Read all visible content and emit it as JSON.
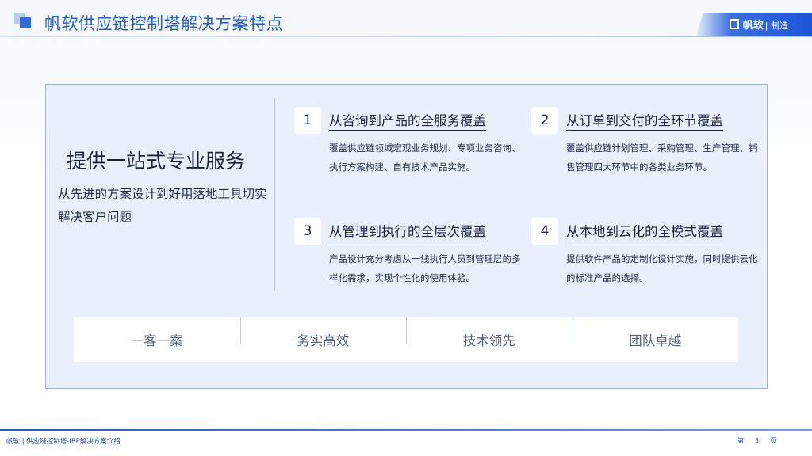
{
  "header": {
    "title": "帆软供应链控制塔解决方案特点",
    "brand": "帆软",
    "brand_sub": "| 制造"
  },
  "left": {
    "title": "提供一站式专业服务",
    "subtitle": "从先进的方案设计到好用落地工具切实解决客户问题"
  },
  "features": [
    {
      "num": "1",
      "title": "从咨询到产品的全服务覆盖",
      "desc": "覆盖供应链领域宏观业务规划、专项业务咨询、执行方案构建、自有技术产品实施。"
    },
    {
      "num": "2",
      "title": "从订单到交付的全环节覆盖",
      "desc": "覆盖供应链计划管理、采购管理、生产管理、销售管理四大环节中的各类业务环节。"
    },
    {
      "num": "3",
      "title": "从管理到执行的全层次覆盖",
      "desc": "产品设计充分考虑从一线执行人员到管理层的多样化需求，实现个性化的使用体验。"
    },
    {
      "num": "4",
      "title": "从本地到云化的全模式覆盖",
      "desc": "提供软件产品的定制化设计实施，同时提供云化的标准产品的选择。"
    }
  ],
  "strip": [
    "一客一案",
    "务实高效",
    "技术领先",
    "团队卓越"
  ],
  "footer": {
    "text": "帆软 | 供应链控制塔-IBP解决方案介绍",
    "page_prefix": "第",
    "page_number": "3",
    "page_suffix": "页"
  },
  "colors": {
    "accent": "#1e5bd6",
    "panel_bg": "#e9f0fb",
    "panel_border": "#9bb2df"
  }
}
